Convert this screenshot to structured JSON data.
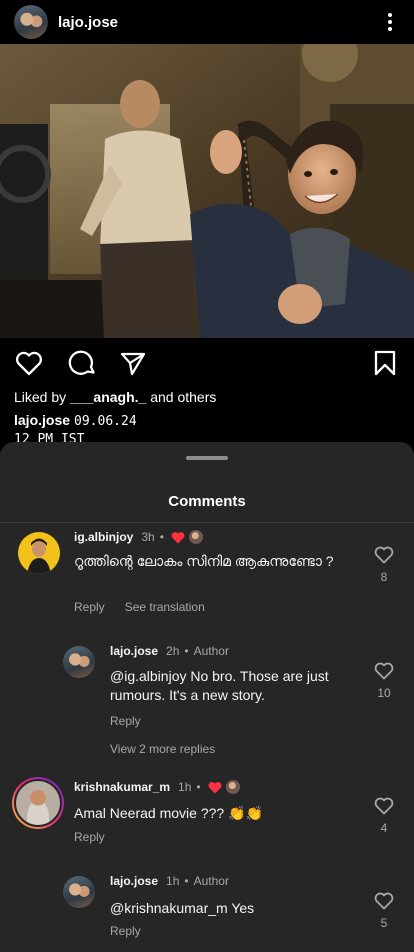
{
  "post": {
    "username": "lajo.jose",
    "liked_by_prefix": "Liked by",
    "liked_by_user": "___anagh._",
    "liked_by_suffix": "and others",
    "caption_user": "lajo.jose",
    "caption_date": "09.06.24",
    "caption_time": "12 PM IST"
  },
  "comments_sheet": {
    "title": "Comments",
    "comments": [
      {
        "username": "ig.albinjoy",
        "time": "3h",
        "text": "റൂത്തിന്റെ ലോകം സിനിമ ആകുന്നുണ്ടോ ?",
        "reply_label": "Reply",
        "translate_label": "See translation",
        "likes": "8"
      },
      {
        "username": "lajo.jose",
        "time": "2h",
        "badge": "Author",
        "text": "@ig.albinjoy No bro. Those are just rumours. It's a new story.",
        "reply_label": "Reply",
        "likes": "10"
      },
      {
        "view_more": "View 2 more replies"
      },
      {
        "username": "krishnakumar_m",
        "time": "1h",
        "text": "Amal Neerad movie ??? 👏👏",
        "reply_label": "Reply",
        "likes": "4"
      },
      {
        "username": "lajo.jose",
        "time": "1h",
        "badge": "Author",
        "text": "@krishnakumar_m Yes",
        "reply_label": "Reply",
        "likes": "5"
      }
    ]
  },
  "colors": {
    "background": "#000000",
    "sheet": "#262626",
    "secondary_text": "#a8a8a8",
    "heart_red": "#ff3040",
    "story_ring": [
      "#f9ce34",
      "#ee2a7b",
      "#6228d7"
    ]
  },
  "icons": [
    "more-vertical-icon",
    "heart-icon",
    "comment-icon",
    "share-icon",
    "bookmark-icon",
    "red-heart-icon",
    "like-heart-icon"
  ]
}
